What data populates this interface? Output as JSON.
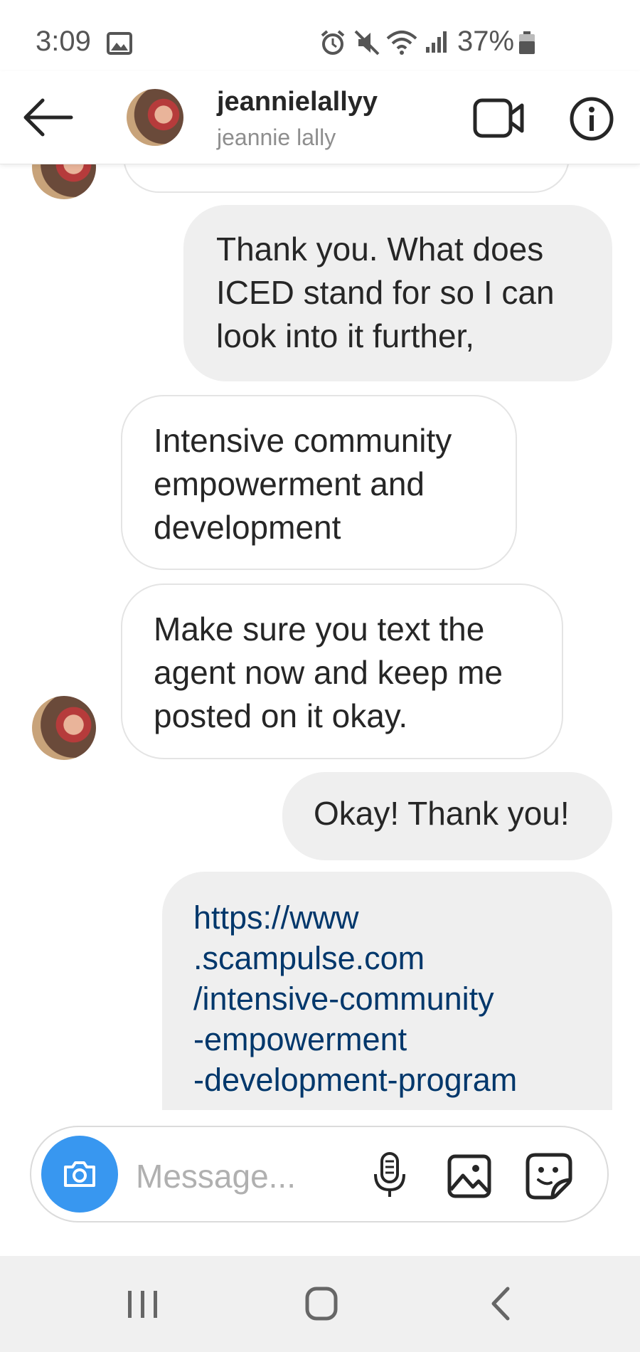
{
  "status_bar": {
    "time": "3:09",
    "battery": "37%"
  },
  "header": {
    "username": "jeannielallyy",
    "full_name": "jeannie lally"
  },
  "messages": [
    {
      "direction": "outgoing",
      "text": "Thank you. What does ICED stand for so I can look into it further,"
    },
    {
      "direction": "incoming",
      "text": "Intensive community empowerment and development"
    },
    {
      "direction": "incoming",
      "text": "Make sure you text the agent now and keep me posted on it okay."
    },
    {
      "direction": "outgoing",
      "text": "Okay! Thank you!"
    },
    {
      "direction": "outgoing",
      "type": "link",
      "text": "https://www\n.scampulse.com\n/intensive-community\n-empowerment\n-development-program"
    }
  ],
  "composer": {
    "placeholder": "Message..."
  },
  "colors": {
    "accent": "#3897f0",
    "link": "#00376b",
    "outgoing_bubble": "#efefef",
    "incoming_border": "#e4e4e4"
  },
  "icons": [
    "back-arrow-icon",
    "video-call-icon",
    "info-icon",
    "camera-icon",
    "microphone-icon",
    "gallery-icon",
    "sticker-icon"
  ]
}
